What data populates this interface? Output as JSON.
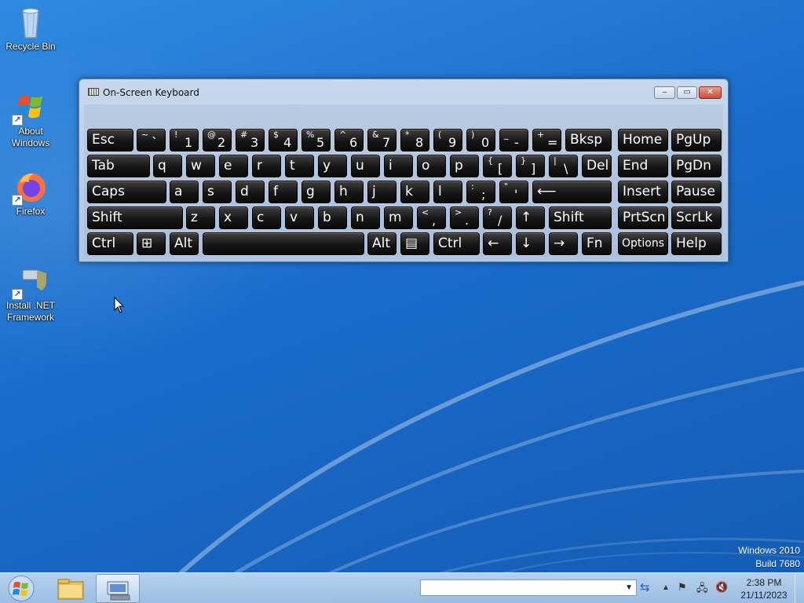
{
  "desktop": {
    "icons": [
      {
        "label": "Recycle Bin",
        "icon": "recycle-bin-icon"
      },
      {
        "label": "About\nWindows",
        "icon": "windows-logo-icon"
      },
      {
        "label": "Firefox",
        "icon": "firefox-icon"
      },
      {
        "label": "Install .NET\nFramework",
        "icon": "shield-installer-icon"
      }
    ]
  },
  "osk": {
    "title": "On-Screen Keyboard",
    "controls": {
      "minimize": "–",
      "maximize": "▭",
      "close": "✕"
    },
    "rows": [
      [
        {
          "label": "Esc"
        },
        {
          "sec": "~",
          "pri": "`"
        },
        {
          "sec": "!",
          "pri": "1"
        },
        {
          "sec": "@",
          "pri": "2"
        },
        {
          "sec": "#",
          "pri": "3"
        },
        {
          "sec": "$",
          "pri": "4"
        },
        {
          "sec": "%",
          "pri": "5"
        },
        {
          "sec": "^",
          "pri": "6"
        },
        {
          "sec": "&",
          "pri": "7"
        },
        {
          "sec": "*",
          "pri": "8"
        },
        {
          "sec": "(",
          "pri": "9"
        },
        {
          "sec": ")",
          "pri": "0"
        },
        {
          "sec": "_",
          "pri": "-"
        },
        {
          "sec": "+",
          "pri": "="
        },
        {
          "label": "Bksp"
        },
        {
          "label": "Home"
        },
        {
          "label": "PgUp"
        }
      ],
      [
        {
          "label": "Tab"
        },
        {
          "label": "q"
        },
        {
          "label": "w"
        },
        {
          "label": "e"
        },
        {
          "label": "r"
        },
        {
          "label": "t"
        },
        {
          "label": "y"
        },
        {
          "label": "u"
        },
        {
          "label": "i"
        },
        {
          "label": "o"
        },
        {
          "label": "p"
        },
        {
          "sec": "{",
          "pri": "["
        },
        {
          "sec": "}",
          "pri": "]"
        },
        {
          "sec": "|",
          "pri": "\\"
        },
        {
          "label": "Del"
        },
        {
          "label": "End"
        },
        {
          "label": "PgDn"
        }
      ],
      [
        {
          "label": "Caps"
        },
        {
          "label": "a"
        },
        {
          "label": "s"
        },
        {
          "label": "d"
        },
        {
          "label": "f"
        },
        {
          "label": "g"
        },
        {
          "label": "h"
        },
        {
          "label": "j"
        },
        {
          "label": "k"
        },
        {
          "label": "l"
        },
        {
          "sec": ":",
          "pri": ";"
        },
        {
          "sec": "\"",
          "pri": "'"
        },
        {
          "label": "⟵"
        },
        {
          "label": "Insert"
        },
        {
          "label": "Pause"
        }
      ],
      [
        {
          "label": "Shift"
        },
        {
          "label": "z"
        },
        {
          "label": "x"
        },
        {
          "label": "c"
        },
        {
          "label": "v"
        },
        {
          "label": "b"
        },
        {
          "label": "n"
        },
        {
          "label": "m"
        },
        {
          "sec": "<",
          "pri": ","
        },
        {
          "sec": ">",
          "pri": "."
        },
        {
          "sec": "?",
          "pri": "/"
        },
        {
          "label": "↑"
        },
        {
          "label": "Shift"
        },
        {
          "label": "PrtScn"
        },
        {
          "label": "ScrLk"
        }
      ],
      [
        {
          "label": "Ctrl"
        },
        {
          "label": "⊞"
        },
        {
          "label": "Alt"
        },
        {
          "label": ""
        },
        {
          "label": "Alt"
        },
        {
          "label": "▤"
        },
        {
          "label": "Ctrl"
        },
        {
          "label": "←"
        },
        {
          "label": "↓"
        },
        {
          "label": "→"
        },
        {
          "label": "Fn"
        },
        {
          "label": "Options",
          "small": true
        },
        {
          "label": "Help"
        }
      ]
    ]
  },
  "watermark": {
    "line1": "Windows 2010",
    "line2": "Build 7680"
  },
  "taskbar": {
    "address_placeholder": "",
    "address_dropdown": "▼",
    "refresh_glyph": "⇆",
    "tray_icons": [
      "show-hidden-icons-icon",
      "action-center-flag-icon",
      "network-icon",
      "volume-muted-icon"
    ],
    "tray_glyphs": {
      "up": "▲",
      "flag": "⚑",
      "net": "🖧",
      "vol": "🔇"
    },
    "time": "2:38 PM",
    "date": "21/11/2023"
  }
}
